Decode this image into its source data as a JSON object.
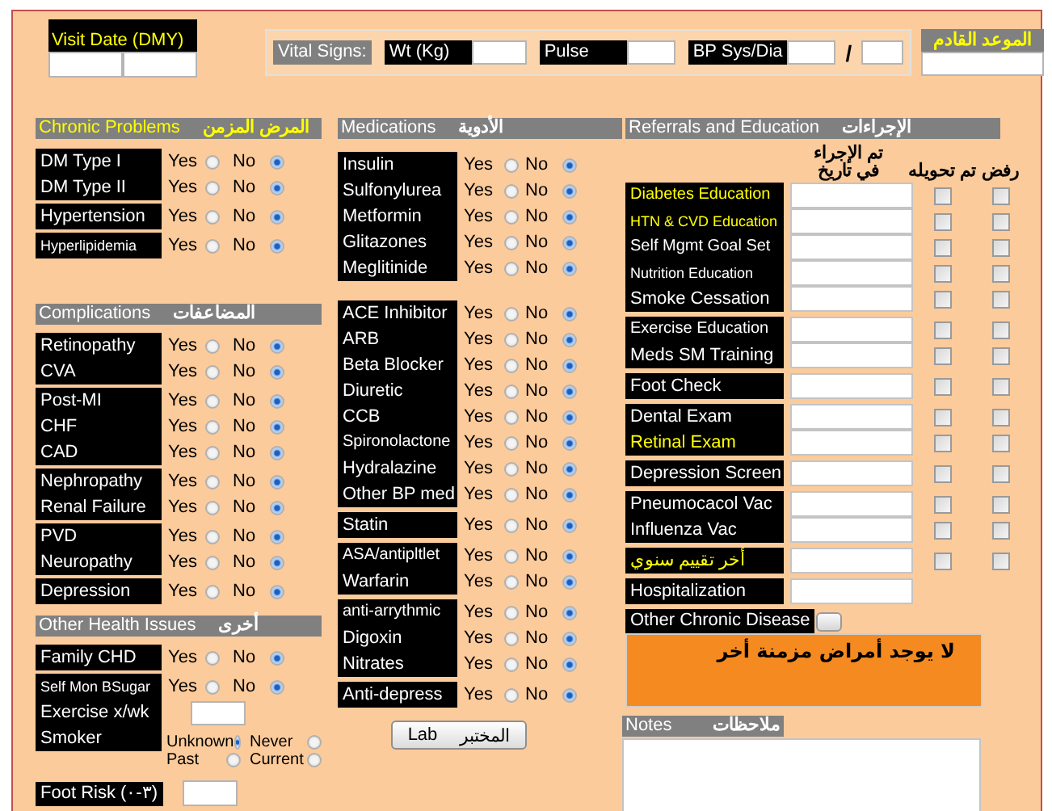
{
  "visit_date": {
    "label": "Visit Date (DMY)"
  },
  "vital_signs": {
    "title": "Vital Signs:",
    "fields": [
      {
        "label": "Wt (Kg)"
      },
      {
        "label": "Pulse"
      },
      {
        "label": "BP Sys/Dia",
        "separator": "/"
      }
    ]
  },
  "next_appointment": {
    "label": "الموعد القادم"
  },
  "sections": [
    {
      "title": "Chronic Problems",
      "title_ar": "المرض المزمن",
      "highlighted": true,
      "groups": [
        [
          {
            "kind": "yes_no",
            "label": "DM Type I",
            "options": [
              {
                "label": "Yes",
                "selected": false
              },
              {
                "label": "No",
                "selected": true
              }
            ]
          },
          {
            "kind": "yes_no",
            "label": "DM Type II",
            "options": [
              {
                "label": "Yes",
                "selected": false
              },
              {
                "label": "No",
                "selected": true
              }
            ]
          }
        ],
        [
          {
            "kind": "yes_no",
            "label": "Hypertension",
            "options": [
              {
                "label": "Yes",
                "selected": false
              },
              {
                "label": "No",
                "selected": true
              }
            ]
          }
        ],
        [
          {
            "kind": "yes_no",
            "label": "Hyperlipidemia",
            "options": [
              {
                "label": "Yes",
                "selected": false
              },
              {
                "label": "No",
                "selected": true
              }
            ]
          }
        ]
      ]
    },
    {
      "title": "Complications",
      "title_ar": "المضاعفات",
      "highlighted": false,
      "groups": [
        [
          {
            "kind": "yes_no",
            "label": "Retinopathy",
            "options": [
              {
                "label": "Yes",
                "selected": false
              },
              {
                "label": "No",
                "selected": true
              }
            ]
          },
          {
            "kind": "yes_no",
            "label": "CVA",
            "options": [
              {
                "label": "Yes",
                "selected": false
              },
              {
                "label": "No",
                "selected": true
              }
            ]
          }
        ],
        [
          {
            "kind": "yes_no",
            "label": "Post-MI",
            "options": [
              {
                "label": "Yes",
                "selected": false
              },
              {
                "label": "No",
                "selected": true
              }
            ]
          },
          {
            "kind": "yes_no",
            "label": "CHF",
            "options": [
              {
                "label": "Yes",
                "selected": false
              },
              {
                "label": "No",
                "selected": true
              }
            ]
          },
          {
            "kind": "yes_no",
            "label": "CAD",
            "options": [
              {
                "label": "Yes",
                "selected": false
              },
              {
                "label": "No",
                "selected": true
              }
            ]
          }
        ],
        [
          {
            "kind": "yes_no",
            "label": "Nephropathy",
            "options": [
              {
                "label": "Yes",
                "selected": false
              },
              {
                "label": "No",
                "selected": true
              }
            ]
          },
          {
            "kind": "yes_no",
            "label": "Renal Failure",
            "options": [
              {
                "label": "Yes",
                "selected": false
              },
              {
                "label": "No",
                "selected": true
              }
            ]
          }
        ],
        [
          {
            "kind": "yes_no",
            "label": "PVD",
            "options": [
              {
                "label": "Yes",
                "selected": false
              },
              {
                "label": "No",
                "selected": true
              }
            ]
          },
          {
            "kind": "yes_no",
            "label": "Neuropathy",
            "options": [
              {
                "label": "Yes",
                "selected": false
              },
              {
                "label": "No",
                "selected": true
              }
            ]
          }
        ],
        [
          {
            "kind": "yes_no",
            "label": "Depression",
            "options": [
              {
                "label": "Yes",
                "selected": false
              },
              {
                "label": "No",
                "selected": true
              }
            ]
          }
        ]
      ]
    },
    {
      "title": "Other Health Issues",
      "title_ar": "أخرى",
      "highlighted": false,
      "groups": [
        [
          {
            "kind": "yes_no",
            "label": "Family CHD",
            "options": [
              {
                "label": "Yes",
                "selected": false
              },
              {
                "label": "No",
                "selected": true
              }
            ]
          }
        ],
        [
          {
            "kind": "yes_no",
            "label": "Self Mon BSugar",
            "options": [
              {
                "label": "Yes",
                "selected": false
              },
              {
                "label": "No",
                "selected": true
              }
            ]
          },
          {
            "kind": "number",
            "label": "Exercise x/wk"
          },
          {
            "kind": "choice",
            "label": "Smoker",
            "options": [
              {
                "label": "Unknown",
                "selected": true
              },
              {
                "label": "Never",
                "selected": false
              },
              {
                "label": "Past",
                "selected": false
              },
              {
                "label": "Current",
                "selected": false
              }
            ]
          }
        ]
      ]
    }
  ],
  "foot_risk": {
    "label": "Foot Risk (٠-٣)"
  },
  "medications": {
    "title": "Medications",
    "title_ar": "الأدوية",
    "groups": [
      [
        {
          "label": "Insulin",
          "options": [
            {
              "label": "Yes",
              "selected": false
            },
            {
              "label": "No",
              "selected": true
            }
          ]
        },
        {
          "label": "Sulfonylurea",
          "options": [
            {
              "label": "Yes",
              "selected": false
            },
            {
              "label": "No",
              "selected": true
            }
          ]
        },
        {
          "label": "Metformin",
          "options": [
            {
              "label": "Yes",
              "selected": false
            },
            {
              "label": "No",
              "selected": true
            }
          ]
        },
        {
          "label": "Glitazones",
          "options": [
            {
              "label": "Yes",
              "selected": false
            },
            {
              "label": "No",
              "selected": true
            }
          ]
        },
        {
          "label": "Meglitinide",
          "options": [
            {
              "label": "Yes",
              "selected": false
            },
            {
              "label": "No",
              "selected": true
            }
          ]
        }
      ],
      [
        {
          "label": "ACE Inhibitor",
          "options": [
            {
              "label": "Yes",
              "selected": false
            },
            {
              "label": "No",
              "selected": true
            }
          ]
        },
        {
          "label": "ARB",
          "options": [
            {
              "label": "Yes",
              "selected": false
            },
            {
              "label": "No",
              "selected": true
            }
          ]
        },
        {
          "label": "Beta Blocker",
          "options": [
            {
              "label": "Yes",
              "selected": false
            },
            {
              "label": "No",
              "selected": true
            }
          ]
        },
        {
          "label": "Diuretic",
          "options": [
            {
              "label": "Yes",
              "selected": false
            },
            {
              "label": "No",
              "selected": true
            }
          ]
        },
        {
          "label": "CCB",
          "options": [
            {
              "label": "Yes",
              "selected": false
            },
            {
              "label": "No",
              "selected": true
            }
          ]
        },
        {
          "label": "Spironolactone",
          "options": [
            {
              "label": "Yes",
              "selected": false
            },
            {
              "label": "No",
              "selected": true
            }
          ]
        },
        {
          "label": "Hydralazine",
          "options": [
            {
              "label": "Yes",
              "selected": false
            },
            {
              "label": "No",
              "selected": true
            }
          ]
        },
        {
          "label": "Other BP med",
          "options": [
            {
              "label": "Yes",
              "selected": false
            },
            {
              "label": "No",
              "selected": true
            }
          ]
        }
      ],
      [
        {
          "label": "Statin",
          "options": [
            {
              "label": "Yes",
              "selected": false
            },
            {
              "label": "No",
              "selected": true
            }
          ]
        }
      ],
      [
        {
          "label": "ASA/antipltlet",
          "options": [
            {
              "label": "Yes",
              "selected": false
            },
            {
              "label": "No",
              "selected": true
            }
          ]
        },
        {
          "label": "Warfarin",
          "options": [
            {
              "label": "Yes",
              "selected": false
            },
            {
              "label": "No",
              "selected": true
            }
          ]
        }
      ],
      [
        {
          "label": "anti-arrythmic",
          "options": [
            {
              "label": "Yes",
              "selected": false
            },
            {
              "label": "No",
              "selected": true
            }
          ]
        },
        {
          "label": "Digoxin",
          "options": [
            {
              "label": "Yes",
              "selected": false
            },
            {
              "label": "No",
              "selected": true
            }
          ]
        },
        {
          "label": "Nitrates",
          "options": [
            {
              "label": "Yes",
              "selected": false
            },
            {
              "label": "No",
              "selected": true
            }
          ]
        }
      ],
      [
        {
          "label": "Anti-depress",
          "options": [
            {
              "label": "Yes",
              "selected": false
            },
            {
              "label": "No",
              "selected": true
            }
          ]
        }
      ]
    ]
  },
  "lab_button": {
    "label": "Lab",
    "label_ar": "المختبر"
  },
  "referrals": {
    "title": "Referrals and Education",
    "title_ar": "الإجراءات",
    "columns": [
      "رفض",
      "تم تحويله",
      "تم الإجراء في تاريخ"
    ],
    "groups": [
      [
        {
          "label": "Diabetes Education",
          "highlighted": true,
          "referred": false,
          "refused": false
        },
        {
          "label": "HTN & CVD Education",
          "highlighted": true,
          "referred": false,
          "refused": false
        },
        {
          "label": "Self Mgmt Goal Set",
          "highlighted": false,
          "referred": false,
          "refused": false
        },
        {
          "label": "Nutrition Education",
          "highlighted": false,
          "referred": false,
          "refused": false
        },
        {
          "label": "Smoke Cessation",
          "highlighted": false,
          "referred": false,
          "refused": false
        }
      ],
      [
        {
          "label": "Exercise Education",
          "highlighted": false,
          "referred": false,
          "refused": false
        },
        {
          "label": "Meds SM Training",
          "highlighted": false,
          "referred": false,
          "refused": false
        }
      ],
      [
        {
          "label": "Foot Check",
          "highlighted": false,
          "referred": false,
          "refused": false
        }
      ],
      [
        {
          "label": "Dental Exam",
          "highlighted": false,
          "referred": false,
          "refused": false
        },
        {
          "label": "Retinal Exam",
          "highlighted": true,
          "referred": false,
          "refused": false
        }
      ],
      [
        {
          "label": "Depression Screen",
          "highlighted": false,
          "referred": false,
          "refused": false
        }
      ],
      [
        {
          "label": "Pneumocacol Vac",
          "highlighted": false,
          "referred": false,
          "refused": false
        },
        {
          "label": "Influenza Vac",
          "highlighted": false,
          "referred": false,
          "refused": false
        }
      ],
      [
        {
          "label": "أخر تقييم سنوي",
          "highlighted": true,
          "referred": false,
          "refused": false
        }
      ],
      [
        {
          "label": "Hospitalization",
          "highlighted": false
        }
      ]
    ]
  },
  "other_chronic_disease": {
    "label": "Other Chronic Disease",
    "text": "لا يوجد أمراض مزمنة أخر"
  },
  "notes": {
    "title": "Notes",
    "title_ar": "ملاحظات"
  }
}
